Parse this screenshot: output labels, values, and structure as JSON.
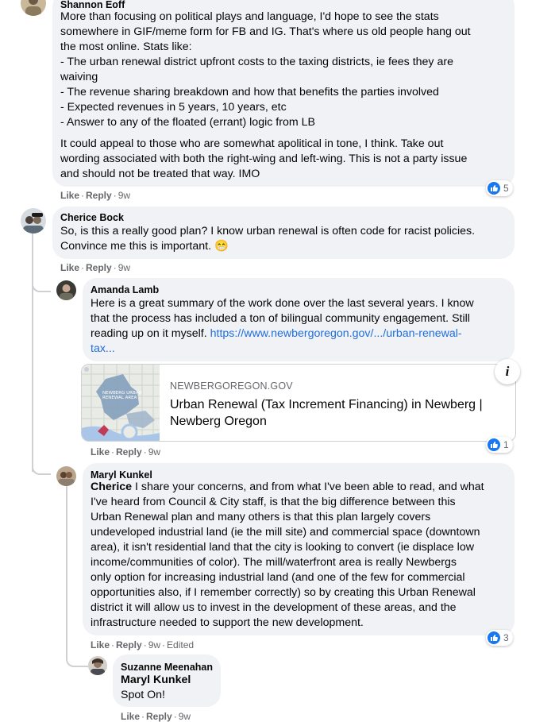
{
  "comments": [
    {
      "author": "Shannon Eoff",
      "lines": [
        "More than focusing on political plays and language, I'd hope to see the stats",
        "somewhere in GIF/meme form for FB and IG. That's where us old people hang out",
        "the most online. Stats like:",
        "- The urban renewal district upfront costs to the taxing districts, ie fees they are",
        "waiving",
        "- The revenue sharing breakdown and how that benefits the parties involved",
        "- Expected revenues in 5 years, 10 years, etc",
        "- Answer to any of the floated (errant) logic from LB"
      ],
      "lines2": [
        "It could appeal to those who are somewhat apolitical in tone, I think. Take out",
        "wording associated with both the right-wing and left-wing. This is not a party issue",
        "and should not be treated that way. IMO"
      ],
      "like": "Like",
      "reply": "Reply",
      "time": "9w",
      "reactions": "5"
    },
    {
      "author": "Cherice Bock",
      "lines": [
        "So, is this a really good plan? I know urban renewal is often code for racist policies.",
        "Convince me this is important. 😁"
      ],
      "like": "Like",
      "reply": "Reply",
      "time": "9w"
    },
    {
      "author": "Amanda Lamb",
      "lines": [
        "Here is a great summary of the work done over the last several years. I know",
        "that the process has included a ton of bilingual community engagement. Still"
      ],
      "line3": "reading up on it myself. ",
      "link1": "https://www.newbergoregon.gov/.../urban-renewal-",
      "link2": "tax...",
      "card": {
        "domain": "NEWBERGOREGON.GOV",
        "title1": "Urban Renewal (Tax Increment Financing) in Newberg |",
        "title2": "Newberg Oregon",
        "info": "i",
        "map_label1": "NEWBERG URBAN",
        "map_label2": "RENEWAL AREA"
      },
      "like": "Like",
      "reply": "Reply",
      "time": "9w",
      "reactions": "1"
    },
    {
      "author": "Maryl Kunkel",
      "mention": "Cherice",
      "first": " I share your concerns, and from what I've been able to read, and what",
      "lines": [
        "I've heard from Council & City staff, is that the big difference between this",
        "Urban Renewal plan and many others is that this plan largely covers",
        "undeveloped industrial land (ie the mill site) and commercial space (downtown",
        "area), it isn't residential land that the city is looking to convert (ie displace low",
        "income/communities of color). The mill/waterfront area is really Newbergs",
        "only option for increasing industrial land (and one of the few for commercial",
        "opportunities also, if I remember correctly) so by creating this Urban Renewal",
        "district it will allow us to invest in the development of these areas, and the",
        "infrastructure needed to support the new development."
      ],
      "like": "Like",
      "reply": "Reply",
      "time": "9w",
      "edited": "Edited",
      "reactions": "3"
    },
    {
      "author": "Suzanne Meenahan",
      "mention": "Maryl Kunkel",
      "text": "Spot On!",
      "like": "Like",
      "reply": "Reply",
      "time": "9w"
    }
  ],
  "colors": {
    "bubble": "#f0f2f5",
    "link": "#216fdb",
    "like": "#1877f2",
    "meta": "#65676b"
  }
}
